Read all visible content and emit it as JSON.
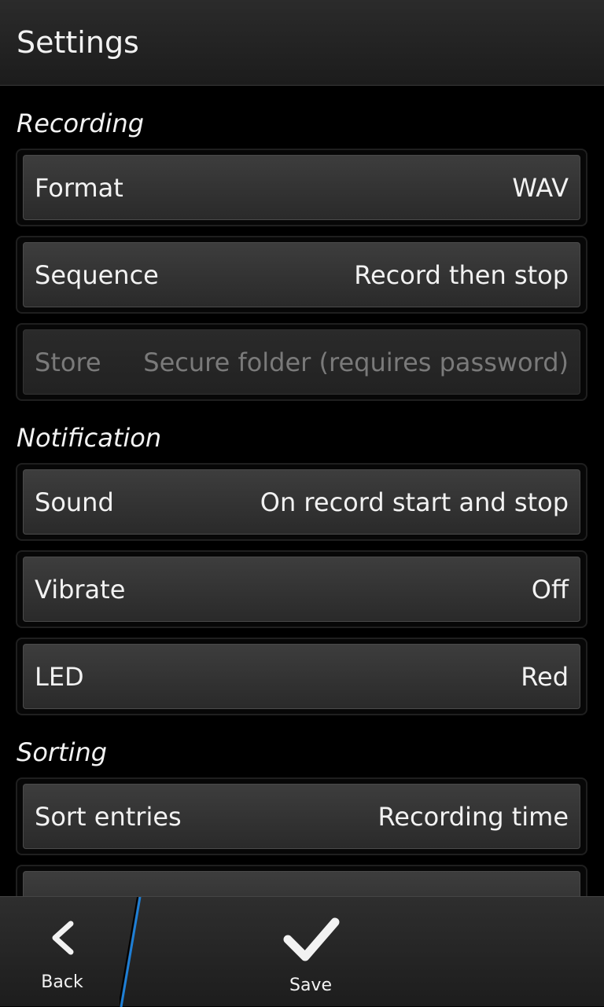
{
  "title": "Settings",
  "sections": [
    {
      "header": "Recording",
      "rows": [
        {
          "label": "Format",
          "value": "WAV"
        },
        {
          "label": "Sequence",
          "value": "Record then stop"
        },
        {
          "label": "Store",
          "value": "Secure folder (requires password)"
        }
      ]
    },
    {
      "header": "Notification",
      "rows": [
        {
          "label": "Sound",
          "value": "On record start and stop"
        },
        {
          "label": "Vibrate",
          "value": "Off"
        },
        {
          "label": "LED",
          "value": "Red"
        }
      ]
    },
    {
      "header": "Sorting",
      "rows": [
        {
          "label": "Sort entries",
          "value": "Recording time"
        }
      ]
    }
  ],
  "actionbar": {
    "back_label": "Back",
    "save_label": "Save"
  },
  "colors": {
    "accent_divider": "#1e7fd6",
    "disabled_text": "#7a7a7a"
  }
}
